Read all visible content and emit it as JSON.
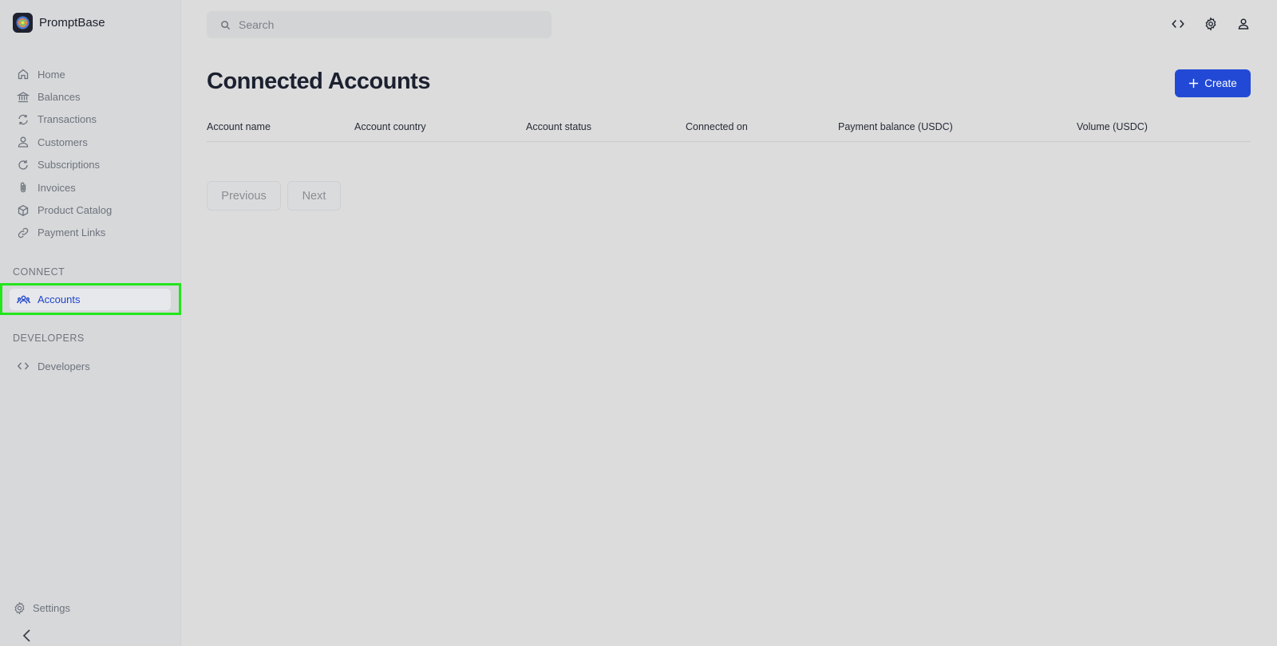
{
  "app": {
    "name": "PromptBase"
  },
  "sidebar": {
    "items": [
      {
        "label": "Home",
        "icon": "home-icon"
      },
      {
        "label": "Balances",
        "icon": "bank-icon"
      },
      {
        "label": "Transactions",
        "icon": "refresh-icon"
      },
      {
        "label": "Customers",
        "icon": "user-icon"
      },
      {
        "label": "Subscriptions",
        "icon": "rotate-icon"
      },
      {
        "label": "Invoices",
        "icon": "paperclip-icon"
      },
      {
        "label": "Product Catalog",
        "icon": "box-icon"
      },
      {
        "label": "Payment Links",
        "icon": "link-icon"
      }
    ],
    "connect_label": "CONNECT",
    "accounts_label": "Accounts",
    "developers_section_label": "DEVELOPERS",
    "developers_label": "Developers",
    "settings_label": "Settings"
  },
  "search": {
    "placeholder": "Search"
  },
  "main": {
    "title": "Connected Accounts",
    "create_label": "Create",
    "columns": [
      "Account name",
      "Account country",
      "Account status",
      "Connected on",
      "Payment balance (USDC)",
      "Volume (USDC)"
    ],
    "previous_label": "Previous",
    "next_label": "Next"
  },
  "colors": {
    "accent": "#2249d6",
    "highlight": "#22e51c"
  }
}
